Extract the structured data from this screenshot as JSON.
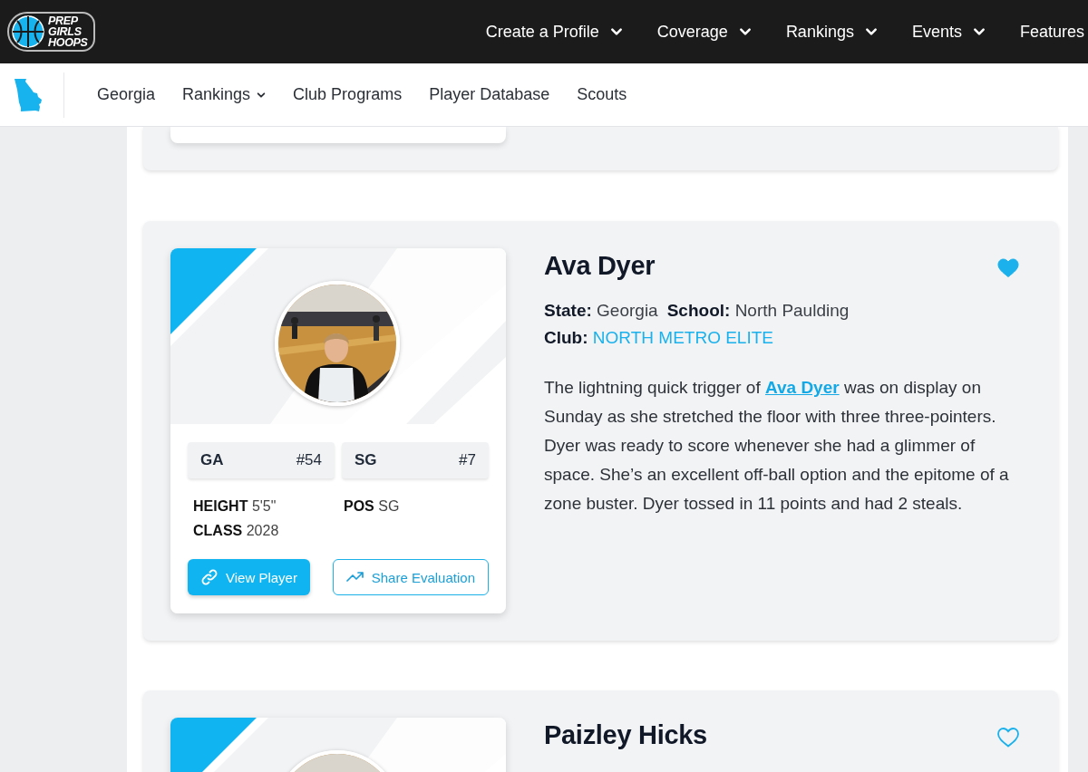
{
  "logo": {
    "lines": [
      "PREP",
      "GIRLS",
      "HOOPS"
    ]
  },
  "top_nav": {
    "items": [
      {
        "label": "Create a Profile",
        "has_dropdown": true
      },
      {
        "label": "Coverage",
        "has_dropdown": true
      },
      {
        "label": "Rankings",
        "has_dropdown": true
      },
      {
        "label": "Events",
        "has_dropdown": true
      },
      {
        "label": "Features",
        "has_dropdown": false
      }
    ]
  },
  "sub_nav": {
    "items": [
      {
        "label": "Georgia",
        "has_dropdown": false
      },
      {
        "label": "Rankings",
        "has_dropdown": true
      },
      {
        "label": "Club Programs",
        "has_dropdown": false
      },
      {
        "label": "Player Database",
        "has_dropdown": false
      },
      {
        "label": "Scouts",
        "has_dropdown": false
      }
    ]
  },
  "players": [
    {
      "name": "Ava Dyer",
      "favorite": true,
      "photo": {
        "kind": "picture"
      },
      "chips": [
        {
          "label": "GA",
          "rank": "#54"
        },
        {
          "label": "SG",
          "rank": "#7"
        }
      ],
      "stats": [
        {
          "label": "HEIGHT",
          "value": "5'5\""
        },
        {
          "label": "POS",
          "value": "SG"
        },
        {
          "label": "CLASS",
          "value": "2028"
        }
      ],
      "buttons": [
        {
          "kind": "primary",
          "label": "View Player"
        },
        {
          "kind": "outline",
          "label": "Share Evaluation"
        }
      ],
      "details": [
        {
          "label": "State:",
          "value": "Georgia",
          "kind": "text"
        },
        {
          "label": "School:",
          "value": "North Paulding",
          "kind": "text"
        },
        {
          "label": "Club:",
          "value": "NORTH METRO ELITE",
          "kind": "link"
        }
      ],
      "evaluation": {
        "before": "The lightning quick trigger of ",
        "link": "Ava Dyer",
        "after": " was on display on Sunday as she stretched the floor with three three-pointers. Dyer was ready to score whenever she had a glimmer of space. She’s an excellent off-ball option and the epitome of a zone buster. Dyer tossed in 11 points and had 2 steals."
      }
    },
    {
      "name": "Paizley Hicks",
      "favorite": false,
      "photo": {
        "kind": "picture"
      }
    }
  ]
}
